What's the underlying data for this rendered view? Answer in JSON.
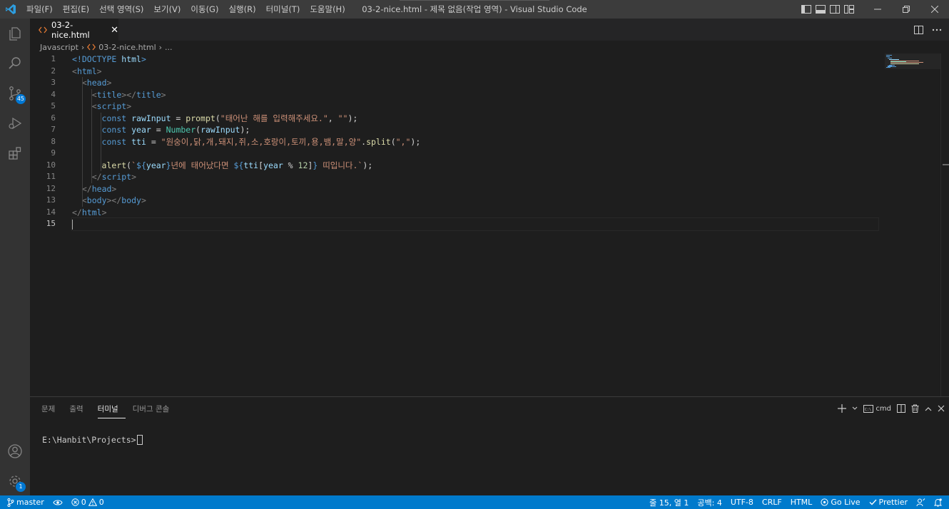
{
  "window": {
    "title": "03-2-nice.html - 제목 없음(작업 영역) - Visual Studio Code",
    "menu": [
      "파일(F)",
      "편집(E)",
      "선택 영역(S)",
      "보기(V)",
      "이동(G)",
      "실행(R)",
      "터미널(T)",
      "도움말(H)"
    ]
  },
  "activity": {
    "scm_badge": "45",
    "settings_badge": "1"
  },
  "tab": {
    "filename": "03-2-nice.html",
    "close_glyph": "✕"
  },
  "breadcrumb": {
    "folder": "Javascript",
    "file": "03-2-nice.html",
    "more": "..."
  },
  "editor": {
    "line_numbers": [
      "1",
      "2",
      "3",
      "4",
      "5",
      "6",
      "7",
      "8",
      "9",
      "10",
      "11",
      "12",
      "13",
      "14",
      "15"
    ],
    "active_line": 15,
    "lines": [
      [
        {
          "t": "<!DOCTYPE ",
          "c": "tag"
        },
        {
          "t": "html",
          "c": "var"
        },
        {
          "t": ">",
          "c": "tag"
        }
      ],
      [
        {
          "t": "<",
          "c": "punct"
        },
        {
          "t": "html",
          "c": "tag"
        },
        {
          "t": ">",
          "c": "punct"
        }
      ],
      [
        {
          "t": "  ",
          "c": "op"
        },
        {
          "t": "<",
          "c": "punct"
        },
        {
          "t": "head",
          "c": "tag"
        },
        {
          "t": ">",
          "c": "punct"
        }
      ],
      [
        {
          "t": "    ",
          "c": "op"
        },
        {
          "t": "<",
          "c": "punct"
        },
        {
          "t": "title",
          "c": "tag"
        },
        {
          "t": "></",
          "c": "punct"
        },
        {
          "t": "title",
          "c": "tag"
        },
        {
          "t": ">",
          "c": "punct"
        }
      ],
      [
        {
          "t": "    ",
          "c": "op"
        },
        {
          "t": "<",
          "c": "punct"
        },
        {
          "t": "script",
          "c": "tag"
        },
        {
          "t": ">",
          "c": "punct"
        }
      ],
      [
        {
          "t": "      ",
          "c": "op"
        },
        {
          "t": "const",
          "c": "kw"
        },
        {
          "t": " ",
          "c": "op"
        },
        {
          "t": "rawInput",
          "c": "var"
        },
        {
          "t": " = ",
          "c": "op"
        },
        {
          "t": "prompt",
          "c": "fn"
        },
        {
          "t": "(",
          "c": "op"
        },
        {
          "t": "\"태어난 해를 입력해주세요.\"",
          "c": "str"
        },
        {
          "t": ", ",
          "c": "op"
        },
        {
          "t": "\"\"",
          "c": "str"
        },
        {
          "t": ");",
          "c": "op"
        }
      ],
      [
        {
          "t": "      ",
          "c": "op"
        },
        {
          "t": "const",
          "c": "kw"
        },
        {
          "t": " ",
          "c": "op"
        },
        {
          "t": "year",
          "c": "var"
        },
        {
          "t": " = ",
          "c": "op"
        },
        {
          "t": "Number",
          "c": "cls"
        },
        {
          "t": "(",
          "c": "op"
        },
        {
          "t": "rawInput",
          "c": "var"
        },
        {
          "t": ");",
          "c": "op"
        }
      ],
      [
        {
          "t": "      ",
          "c": "op"
        },
        {
          "t": "const",
          "c": "kw"
        },
        {
          "t": " ",
          "c": "op"
        },
        {
          "t": "tti",
          "c": "var"
        },
        {
          "t": " = ",
          "c": "op"
        },
        {
          "t": "\"원숭이,닭,개,돼지,쥐,소,호랑이,토끼,용,뱀,말,양\"",
          "c": "str"
        },
        {
          "t": ".",
          "c": "op"
        },
        {
          "t": "split",
          "c": "fn"
        },
        {
          "t": "(",
          "c": "op"
        },
        {
          "t": "\",\"",
          "c": "str"
        },
        {
          "t": ");",
          "c": "op"
        }
      ],
      [],
      [
        {
          "t": "      ",
          "c": "op"
        },
        {
          "t": "alert",
          "c": "fn"
        },
        {
          "t": "(",
          "c": "op"
        },
        {
          "t": "`",
          "c": "str"
        },
        {
          "t": "${",
          "c": "tmpl"
        },
        {
          "t": "year",
          "c": "var"
        },
        {
          "t": "}",
          "c": "tmpl"
        },
        {
          "t": "년에 태어났다면 ",
          "c": "str"
        },
        {
          "t": "${",
          "c": "tmpl"
        },
        {
          "t": "tti",
          "c": "var"
        },
        {
          "t": "[",
          "c": "op"
        },
        {
          "t": "year",
          "c": "var"
        },
        {
          "t": " % ",
          "c": "op"
        },
        {
          "t": "12",
          "c": "num"
        },
        {
          "t": "]",
          "c": "op"
        },
        {
          "t": "}",
          "c": "tmpl"
        },
        {
          "t": " 띠입니다.`",
          "c": "str"
        },
        {
          "t": ");",
          "c": "op"
        }
      ],
      [
        {
          "t": "    ",
          "c": "op"
        },
        {
          "t": "</",
          "c": "punct"
        },
        {
          "t": "script",
          "c": "tag"
        },
        {
          "t": ">",
          "c": "punct"
        }
      ],
      [
        {
          "t": "  ",
          "c": "op"
        },
        {
          "t": "</",
          "c": "punct"
        },
        {
          "t": "head",
          "c": "tag"
        },
        {
          "t": ">",
          "c": "punct"
        }
      ],
      [
        {
          "t": "  ",
          "c": "op"
        },
        {
          "t": "<",
          "c": "punct"
        },
        {
          "t": "body",
          "c": "tag"
        },
        {
          "t": "></",
          "c": "punct"
        },
        {
          "t": "body",
          "c": "tag"
        },
        {
          "t": ">",
          "c": "punct"
        }
      ],
      [
        {
          "t": "</",
          "c": "punct"
        },
        {
          "t": "html",
          "c": "tag"
        },
        {
          "t": ">",
          "c": "punct"
        }
      ],
      []
    ]
  },
  "panel": {
    "tabs": [
      "문제",
      "출력",
      "터미널",
      "디버그 콘솔"
    ],
    "active_tab": "터미널",
    "shell_label": "cmd",
    "terminal_prompt": "E:\\Hanbit\\Projects>"
  },
  "statusbar": {
    "branch": "master",
    "errors": "0",
    "warnings": "0",
    "position": "줄 15, 열 1",
    "spaces": "공백: 4",
    "encoding": "UTF-8",
    "eol": "CRLF",
    "language": "HTML",
    "golive": "Go Live",
    "prettier": "Prettier"
  },
  "colors": {
    "statusbar": "#007acc",
    "activitybar": "#333333",
    "titlebar": "#3c3c3c",
    "editor": "#1e1e1e",
    "badge": "#0078d4"
  }
}
